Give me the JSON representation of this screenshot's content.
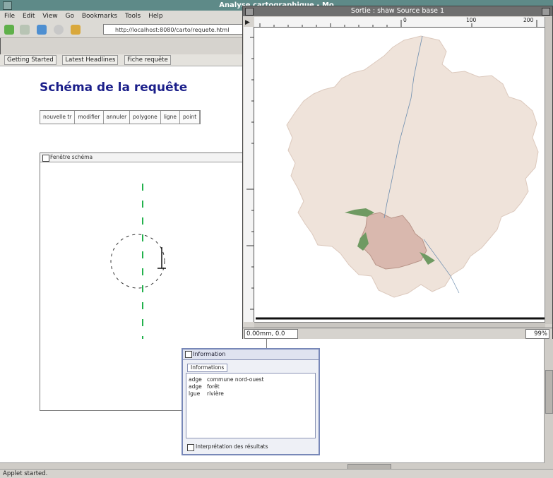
{
  "browser": {
    "title": "Analyse cartographique - Mo",
    "menu": [
      "File",
      "Edit",
      "View",
      "Go",
      "Bookmarks",
      "Tools",
      "Help"
    ],
    "url": "http://localhost:8080/carto/requete.html",
    "bookmarks": [
      "Getting Started",
      "Latest Headlines",
      "Fiche requête"
    ],
    "page_title": "Schéma de la requête",
    "schema_columns": [
      "nouvelle tr",
      "modifier",
      "annuler",
      "polygone",
      "ligne",
      "point"
    ],
    "schema_frame_title": "Fenêtre schéma",
    "status": "Applet started."
  },
  "info_dialog": {
    "title": "Information",
    "tab": "Informations",
    "rows": [
      {
        "key": "adge",
        "value": "commune nord-ouest"
      },
      {
        "key": "adge",
        "value": "forêt"
      },
      {
        "key": "lgue",
        "value": "rivière"
      }
    ],
    "footer": "Interprétation des résultats"
  },
  "map_window": {
    "title": "Sortie : shaw Source base 1",
    "ruler_marks": [
      "0",
      "100",
      "200"
    ],
    "coord": "0.00mm, 0.0",
    "zoom": "99%"
  },
  "colors": {
    "region_fill": "#efe3da",
    "region_stroke": "#dcc9bd",
    "highlight_fill": "#d9b8ae",
    "river": "#6f8fb0",
    "forest": "#6f9a62",
    "query_line": "#22b14c"
  }
}
